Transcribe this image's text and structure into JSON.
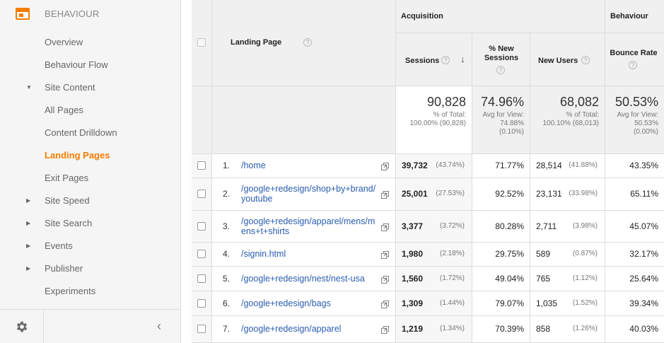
{
  "sidebar": {
    "section_title": "BEHAVIOUR",
    "items": [
      {
        "label": "Overview"
      },
      {
        "label": "Behaviour Flow"
      },
      {
        "label": "Site Content"
      },
      {
        "label": "All Pages"
      },
      {
        "label": "Content Drilldown"
      },
      {
        "label": "Landing Pages"
      },
      {
        "label": "Exit Pages"
      },
      {
        "label": "Site Speed"
      },
      {
        "label": "Site Search"
      },
      {
        "label": "Events"
      },
      {
        "label": "Publisher"
      },
      {
        "label": "Experiments"
      }
    ],
    "collapse_glyph": "‹"
  },
  "table": {
    "group_acquisition": "Acquisition",
    "group_behaviour": "Behaviour",
    "col_landing": "Landing Page",
    "col_sessions": "Sessions",
    "col_new_sessions_1": "% New",
    "col_new_sessions_2": "Sessions",
    "col_new_users": "New Users",
    "col_bounce": "Bounce Rate",
    "help_glyph": "?",
    "sort_glyph": "↓",
    "totals": {
      "sessions": "90,828",
      "sessions_sub1": "% of Total:",
      "sessions_sub2": "100.00% (90,828)",
      "new_sessions": "74.96%",
      "new_sessions_sub1": "Avg for View:",
      "new_sessions_sub2": "74.88%",
      "new_sessions_sub3": "(0.10%)",
      "new_users": "68,082",
      "new_users_sub1": "% of Total:",
      "new_users_sub2": "100.10% (68,013)",
      "bounce": "50.53%",
      "bounce_sub1": "Avg for View:",
      "bounce_sub2": "50.53%",
      "bounce_sub3": "(0.00%)"
    },
    "rows": [
      {
        "rank": "1.",
        "page": "/home",
        "sessions": "39,732",
        "sessions_pct": "(43.74%)",
        "new_sessions": "71.77%",
        "new_users": "28,514",
        "new_users_pct": "(41.88%)",
        "bounce": "43.35%"
      },
      {
        "rank": "2.",
        "page": "/google+redesign/shop+by+brand/youtube",
        "sessions": "25,001",
        "sessions_pct": "(27.53%)",
        "new_sessions": "92.52%",
        "new_users": "23,131",
        "new_users_pct": "(33.98%)",
        "bounce": "65.11%"
      },
      {
        "rank": "3.",
        "page": "/google+redesign/apparel/mens/mens+t+shirts",
        "sessions": "3,377",
        "sessions_pct": "(3.72%)",
        "new_sessions": "80.28%",
        "new_users": "2,711",
        "new_users_pct": "(3.98%)",
        "bounce": "45.07%"
      },
      {
        "rank": "4.",
        "page": "/signin.html",
        "sessions": "1,980",
        "sessions_pct": "(2.18%)",
        "new_sessions": "29.75%",
        "new_users": "589",
        "new_users_pct": "(0.87%)",
        "bounce": "32.17%"
      },
      {
        "rank": "5.",
        "page": "/google+redesign/nest/nest-usa",
        "sessions": "1,560",
        "sessions_pct": "(1.72%)",
        "new_sessions": "49.04%",
        "new_users": "765",
        "new_users_pct": "(1.12%)",
        "bounce": "25.64%"
      },
      {
        "rank": "6.",
        "page": "/google+redesign/bags",
        "sessions": "1,309",
        "sessions_pct": "(1.44%)",
        "new_sessions": "79.07%",
        "new_users": "1,035",
        "new_users_pct": "(1.52%)",
        "bounce": "39.34%"
      },
      {
        "rank": "7.",
        "page": "/google+redesign/apparel",
        "sessions": "1,219",
        "sessions_pct": "(1.34%)",
        "new_sessions": "70.39%",
        "new_users": "858",
        "new_users_pct": "(1.26%)",
        "bounce": "40.03%"
      }
    ]
  },
  "colors": {
    "accent": "#f57c00",
    "link": "#2a5db0",
    "header_bg": "#f0f0f0",
    "sidebar_bg": "#f5f5f5"
  }
}
